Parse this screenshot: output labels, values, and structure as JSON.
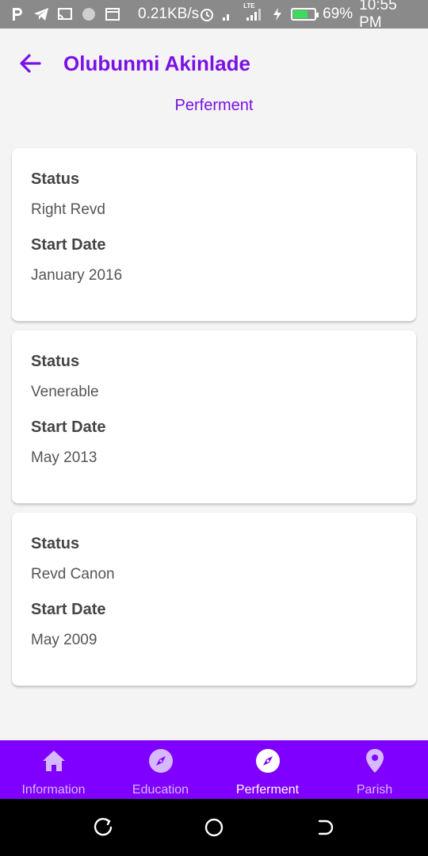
{
  "status_bar": {
    "speed": "0.21KB/s",
    "network": "LTE",
    "battery_percent": "69%",
    "battery_level": 0.69,
    "time": "10:55 PM"
  },
  "header": {
    "title": "Olubunmi Akinlade",
    "subtitle": "Perferment"
  },
  "cards": [
    {
      "status_label": "Status",
      "status_value": "Right Revd",
      "date_label": "Start Date",
      "date_value": "January 2016"
    },
    {
      "status_label": "Status",
      "status_value": "Venerable",
      "date_label": "Start Date",
      "date_value": "May 2013"
    },
    {
      "status_label": "Status",
      "status_value": "Revd Canon",
      "date_label": "Start Date",
      "date_value": "May 2009"
    }
  ],
  "bottom_nav": {
    "items": [
      {
        "label": "Information",
        "icon": "home-icon",
        "active": false
      },
      {
        "label": "Education",
        "icon": "compass-icon",
        "active": false
      },
      {
        "label": "Perferment",
        "icon": "compass-icon",
        "active": true
      },
      {
        "label": "Parish",
        "icon": "location-pin-icon",
        "active": false
      }
    ]
  },
  "colors": {
    "accent": "#7a10e4",
    "nav_background": "#8000ff",
    "status_bar": "#8a8a8a"
  }
}
